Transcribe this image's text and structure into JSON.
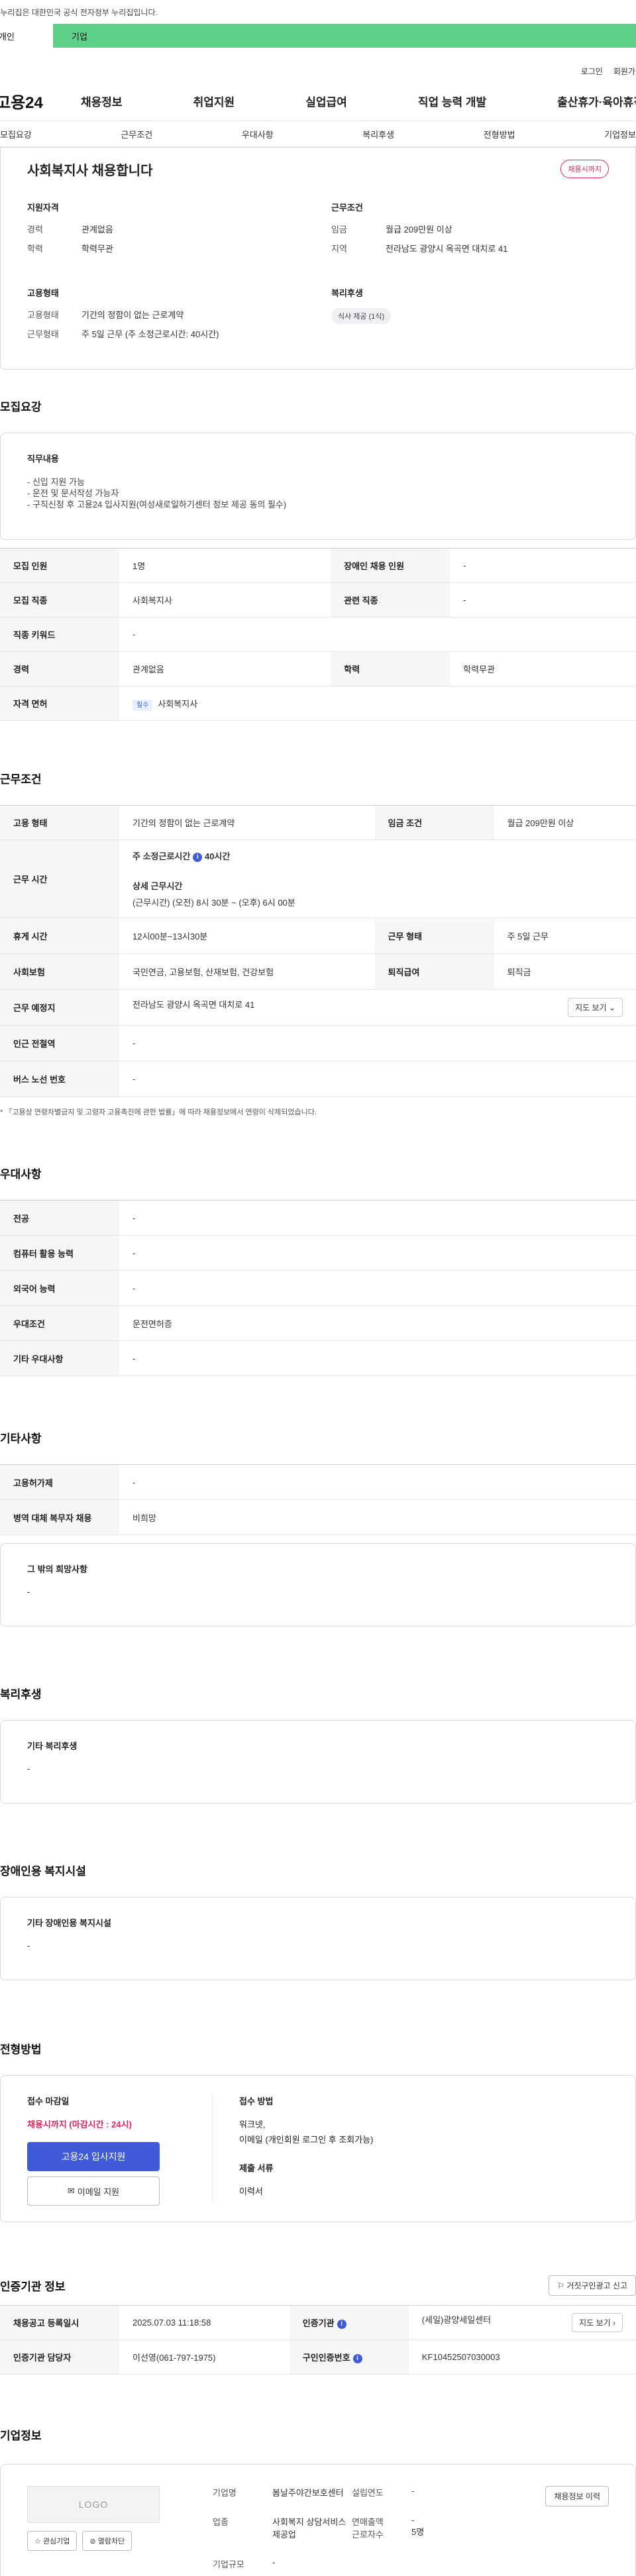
{
  "gov_banner": "이 누리집은 대한민국 공식 전자정부 누리집입니다.",
  "audience": {
    "individual": "개인",
    "company": "기업"
  },
  "util": {
    "login": "로그인",
    "signup": "회원가입"
  },
  "gnb": {
    "logo": "고용24",
    "menu": [
      "채용정보",
      "취업지원",
      "실업급여",
      "직업 능력 개발",
      "출산휴가·육아휴직"
    ]
  },
  "tabs": [
    "모집요강",
    "근무조건",
    "우대사항",
    "복리후생",
    "전형방법",
    "기업정보"
  ],
  "summary": {
    "title": "사회복지사 채용합니다",
    "deadline_badge": "채용시까지",
    "qualification": {
      "heading": "지원자격",
      "rows": [
        {
          "k": "경력",
          "v": "관계없음"
        },
        {
          "k": "학력",
          "v": "학력무관"
        }
      ]
    },
    "work_conditions": {
      "heading": "근무조건",
      "rows": [
        {
          "k": "임금",
          "v": "월급 209만원 이상"
        },
        {
          "k": "지역",
          "v": "전라남도 광양시 옥곡면 대치로 41"
        }
      ]
    },
    "employment": {
      "heading": "고용형태",
      "rows": [
        {
          "k": "고용형태",
          "v": "기간의 정함이 없는 근로계약"
        },
        {
          "k": "근무형태",
          "v": "주 5일 근무 (주 소정근로시간: 40시간)"
        }
      ]
    },
    "welfare": {
      "heading": "복리후생",
      "chip": "식사 제공 (1식)"
    }
  },
  "recruit": {
    "section_title": "모집요강",
    "duties_heading": "직무내용",
    "duties": [
      "- 신입 지원 가능",
      "- 운전 및 문서작성 가능자",
      "- 구직신청 후 고용24 입사지원(여성새로일하기센터 정보 제공 동의 필수)"
    ],
    "table": {
      "r1": {
        "k1": "모집 인원",
        "v1": "1명",
        "k2": "장애인 채용 인원",
        "v2": "-"
      },
      "r2": {
        "k1": "모집 직종",
        "v1": "사회복지사",
        "k2": "관련 직종",
        "v2": "-"
      },
      "r3": {
        "k1": "직종 키워드",
        "v1": "-"
      },
      "r4": {
        "k1": "경력",
        "v1": "관계없음",
        "k2": "학력",
        "v2": "학력무관"
      },
      "r5": {
        "k1": "자격 면허",
        "chip": "필수",
        "v1": "사회복지사"
      }
    }
  },
  "conditions": {
    "section_title": "근무조건",
    "employment_type": {
      "k1": "고용 형태",
      "v1": "기간의 정함이 없는 근로계약",
      "k2": "임금 조건",
      "v2": "월급 209만원 이상"
    },
    "work_time": {
      "k": "근무 시간",
      "weekly_label": "주 소정근로시간",
      "weekly_value": "40시간",
      "detail_label": "상세 근무시간",
      "detail_value": "(근무시간) (오전) 8시 30분 ~ (오후) 6시 00분"
    },
    "break": {
      "k1": "휴게 시간",
      "v1": "12시00분~13시30분",
      "k2": "근무 형태",
      "v2": "주 5일 근무"
    },
    "insurance": {
      "k1": "사회보험",
      "v1": "국민연금, 고용보험, 산재보험, 건강보험",
      "k2": "퇴직급여",
      "v2": "퇴직금"
    },
    "location": {
      "k": "근무 예정지",
      "v": "전라남도 광양시 옥곡면 대치로 41",
      "map_btn": "지도 보기"
    },
    "subway": {
      "k": "인근 전철역",
      "v": "-"
    },
    "bus": {
      "k": "버스 노선 번호",
      "v": "-"
    },
    "note": "* 「고용상 연령차별금지 및 고령자 고용촉진에 관한 법률」에 따라 채용정보에서 연령이 삭제되었습니다."
  },
  "preferences": {
    "section_title": "우대사항",
    "rows": [
      {
        "k": "전공",
        "v": "-"
      },
      {
        "k": "컴퓨터 활용 능력",
        "v": "-"
      },
      {
        "k": "외국어 능력",
        "v": "-"
      },
      {
        "k": "우대조건",
        "v": "운전면허증"
      },
      {
        "k": "기타 우대사항",
        "v": "-"
      }
    ]
  },
  "others": {
    "section_title": "기타사항",
    "rows": [
      {
        "k": "고용허가제",
        "v": "-"
      },
      {
        "k": "병역 대체 복무자 채용",
        "v": "비희망"
      }
    ],
    "wish_heading": "그 밖의 희망사항",
    "wish_value": "-"
  },
  "benefits": {
    "section_title": "복리후생",
    "heading": "기타 복리후생",
    "value": "-"
  },
  "disability": {
    "section_title": "장애인용 복지시설",
    "heading": "기타 장애인용 복지시설",
    "value": "-"
  },
  "selection": {
    "section_title": "전형방법",
    "deadline_heading": "접수 마감일",
    "deadline_value": "채용시까지 (마감시간 : 24시)",
    "apply_btn": "고용24 입사지원",
    "email_btn": "이메일 지원",
    "method_heading": "접수 방법",
    "methods": [
      "워크넷,",
      "이메일 (개인회원 로그인 후 조회가능)"
    ],
    "docs_heading": "제출 서류",
    "docs_value": "이력서"
  },
  "cert": {
    "section_title": "인증기관 정보",
    "report_btn": "거짓구인광고 신고",
    "r1": {
      "k1": "채용공고 등록일시",
      "v1": "2025.07.03 11:18:58",
      "k2": "인증기관",
      "v2": "(세일)광양세일센터",
      "btn": "지도 보기"
    },
    "r2": {
      "k1": "인증기관 담당자",
      "v1": "이선영(061-797-1975)",
      "k2": "구인인증번호",
      "v2": "KF10452507030003"
    }
  },
  "company": {
    "section_title": "기업정보",
    "logo_text": "LOGO",
    "fav_btn": "관심기업",
    "block_btn": "열람차단",
    "history_btn": "채용정보 이력",
    "name_k": "기업명",
    "name_v": "봄날주야간보호센터",
    "founded_k": "설립연도",
    "founded_v": "-",
    "industry_k": "업종",
    "industry_v": "사회복지 상담서비스 제공업",
    "sales_k": "연매출액",
    "sales_v": "-",
    "employees_k": "근로자수",
    "employees_v": "5명",
    "size_k": "기업규모",
    "size_v": "-"
  }
}
